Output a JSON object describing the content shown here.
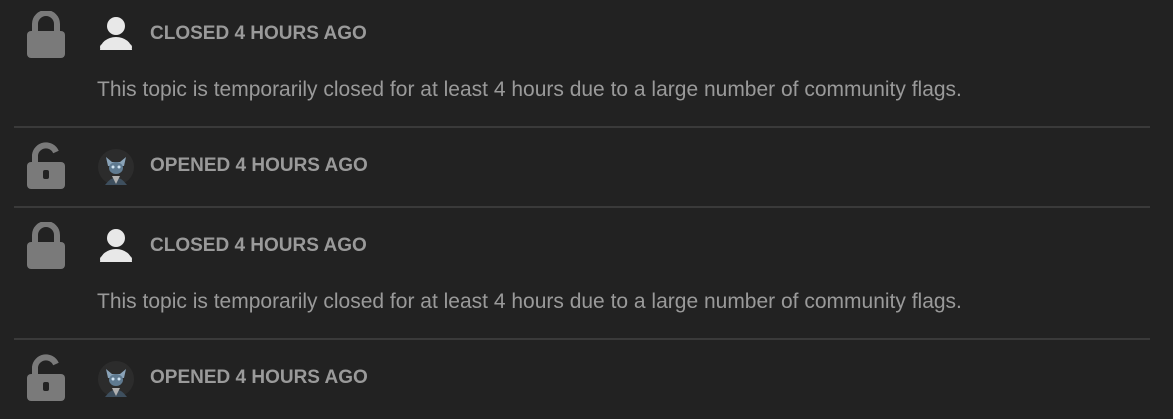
{
  "events": [
    {
      "type": "closed",
      "lock_icon": "lock-closed-icon",
      "avatar_icon": "default-user-avatar-icon",
      "action": "CLOSED 4 HOURS AGO",
      "message": "This topic is temporarily closed for at least 4 hours due to a large number of community flags."
    },
    {
      "type": "opened",
      "lock_icon": "lock-open-icon",
      "avatar_icon": "system-user-avatar-icon",
      "action": "OPENED 4 HOURS AGO"
    },
    {
      "type": "closed",
      "lock_icon": "lock-closed-icon",
      "avatar_icon": "default-user-avatar-icon",
      "action": "CLOSED 4 HOURS AGO",
      "message": "This topic is temporarily closed for at least 4 hours due to a large number of community flags."
    },
    {
      "type": "opened",
      "lock_icon": "lock-open-icon",
      "avatar_icon": "system-user-avatar-icon",
      "action": "OPENED 4 HOURS AGO"
    }
  ],
  "colors": {
    "background": "#222222",
    "text": "#9a9a9a",
    "icon": "#7a7a7a",
    "divider": "#3a3a3a",
    "avatar": "#e8e8e8"
  }
}
